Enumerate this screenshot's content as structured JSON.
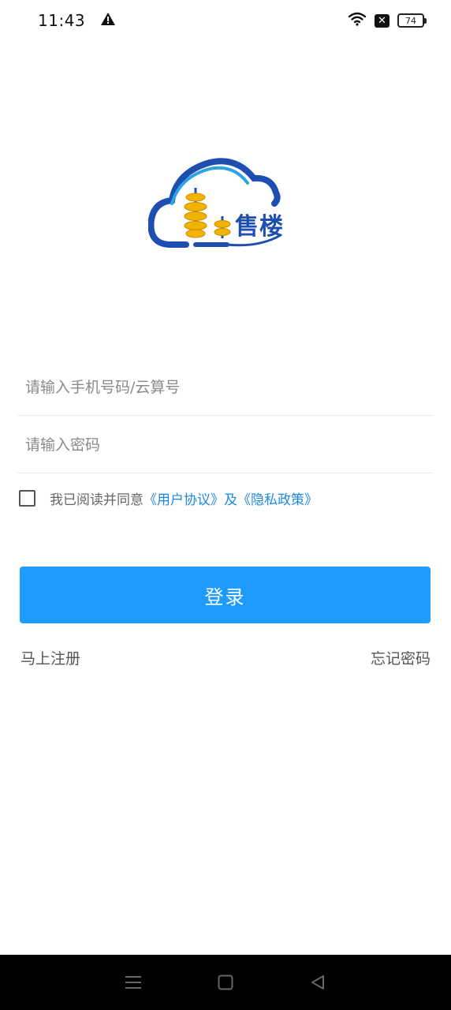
{
  "status_bar": {
    "time": "11:43",
    "battery": "74",
    "icons": [
      "warning-icon",
      "wifi-icon",
      "no-sim-icon",
      "battery-icon"
    ]
  },
  "logo": {
    "text": "售楼",
    "colors": {
      "blue": "#1e4fb0",
      "light_blue": "#2aa3e8",
      "gold": "#f0b400"
    }
  },
  "form": {
    "phone_placeholder": "请输入手机号码/云算号",
    "password_placeholder": "请输入密码",
    "agree_prefix": "我已阅读并同意",
    "user_agreement": "《用户协议》",
    "and": "及",
    "privacy_policy": "《隐私政策》",
    "agreed": false
  },
  "login_button": "登录",
  "links": {
    "register": "马上注册",
    "forgot_password": "忘记密码"
  },
  "colors": {
    "primary": "#1e9bff",
    "link": "#1e88e5"
  }
}
